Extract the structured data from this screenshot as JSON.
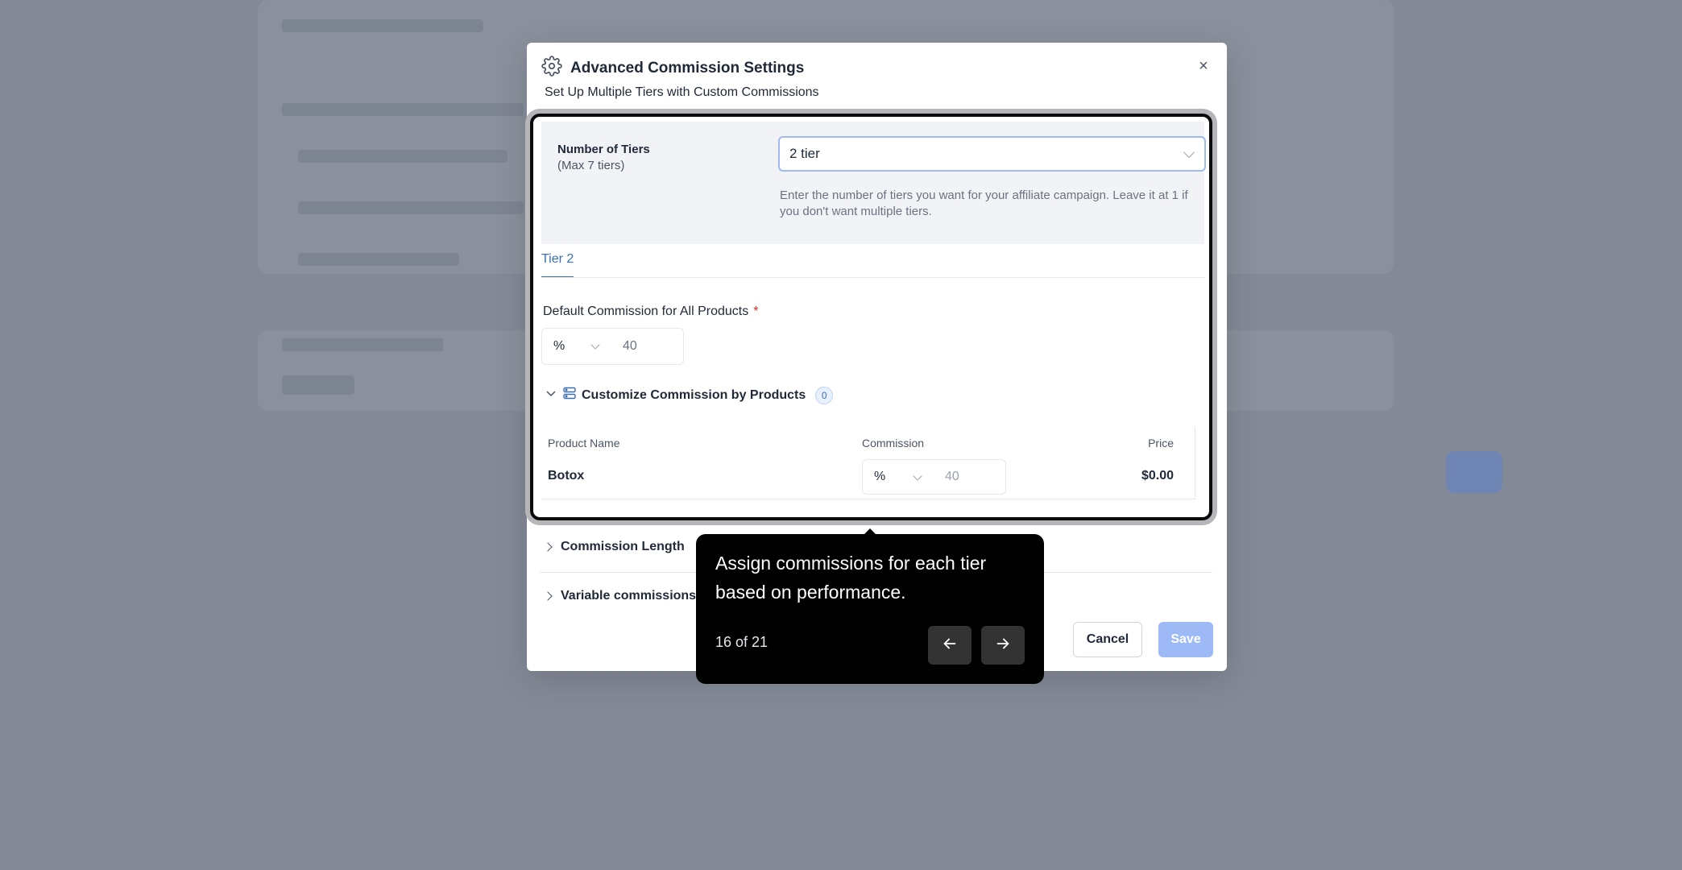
{
  "modal": {
    "title": "Advanced Commission Settings",
    "subtitle": "Set Up Multiple Tiers with Custom Commissions",
    "close_glyph": "×"
  },
  "tiers": {
    "label": "Number of Tiers",
    "sublabel": "(Max 7 tiers)",
    "selected": "2 tier",
    "help": "Enter the number of tiers you want for your affiliate campaign. Leave it at 1 if you don't want multiple tiers."
  },
  "tabs": [
    {
      "label": "Tier 2"
    }
  ],
  "default_commission": {
    "label": "Default Commission for All Products",
    "required_marker": "*",
    "unit": "%",
    "value": "40"
  },
  "customize": {
    "label": "Customize Commission by Products",
    "count": "0"
  },
  "products_table": {
    "columns": [
      "Product Name",
      "Commission",
      "Price"
    ],
    "rows": [
      {
        "name": "Botox",
        "unit": "%",
        "value": "40",
        "price": "$0.00"
      }
    ]
  },
  "sections": [
    {
      "label": "Commission Length"
    },
    {
      "label": "Variable commissions"
    }
  ],
  "footer": {
    "cancel_label": "Cancel",
    "save_label": "Save"
  },
  "tooltip": {
    "text": "Assign commissions for each tier based on performance.",
    "progress": "16 of 21"
  },
  "colors": {
    "overlay": "#838996",
    "accent": "#3b6fb6",
    "save_button": "#9dbaf7",
    "tooltip_bg": "#000000",
    "required": "#dc2626"
  },
  "icons": [
    "gear-icon",
    "close-icon",
    "chevron-down-icon",
    "chevron-right-icon",
    "product-list-icon",
    "arrow-left-icon",
    "arrow-right-icon"
  ]
}
